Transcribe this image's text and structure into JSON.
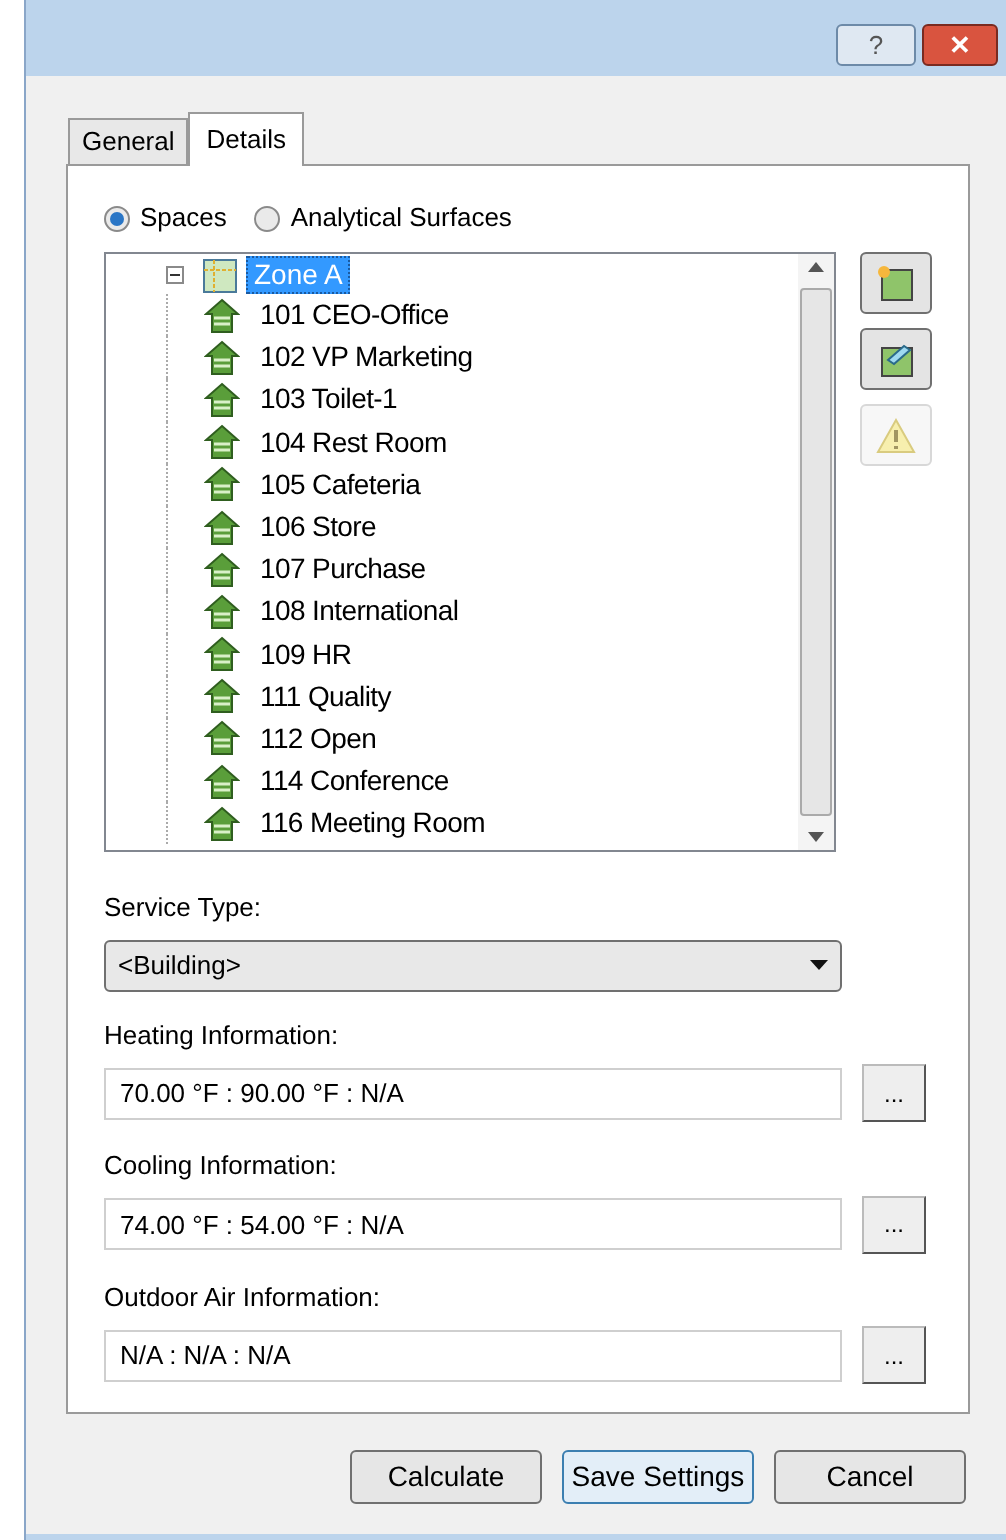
{
  "title_bar": {
    "buttons": [
      {
        "kind": "help",
        "label": "?"
      },
      {
        "kind": "close",
        "label": "✕"
      }
    ]
  },
  "tabs": [
    {
      "label": "General",
      "selected": false
    },
    {
      "label": "Details",
      "selected": true
    }
  ],
  "radios": [
    {
      "label": "Spaces",
      "selected": true
    },
    {
      "label": "Analytical Surfaces",
      "selected": false
    }
  ],
  "tree": {
    "root": {
      "label": "Zone A",
      "expanded": true,
      "selected": true,
      "children": [
        {
          "label": "101 CEO-Office"
        },
        {
          "label": "102 VP Marketing"
        },
        {
          "label": "103 Toilet-1"
        },
        {
          "label": "104 Rest Room"
        },
        {
          "label": "105 Cafeteria"
        },
        {
          "label": "106 Store"
        },
        {
          "label": "107 Purchase"
        },
        {
          "label": "108 International"
        },
        {
          "label": "109 HR"
        },
        {
          "label": "111 Quality"
        },
        {
          "label": "112 Open"
        },
        {
          "label": "114 Conference"
        },
        {
          "label": "116 Meeting Room"
        }
      ]
    }
  },
  "side_buttons": [
    {
      "kind": "space",
      "disabled": false
    },
    {
      "kind": "edit",
      "disabled": false
    },
    {
      "kind": "warning",
      "disabled": true
    }
  ],
  "service_type": {
    "label": "Service Type:",
    "value": "<Building>"
  },
  "fields": [
    {
      "label": "Heating Information:",
      "value": "70.00 °F : 90.00 °F : N/A",
      "button": "..."
    },
    {
      "label": "Cooling Information:",
      "value": "74.00 °F : 54.00 °F : N/A",
      "button": "..."
    },
    {
      "label": "Outdoor Air Information:",
      "value": "N/A : N/A : N/A",
      "button": "..."
    }
  ],
  "buttons": [
    {
      "label": "Calculate",
      "selected": false
    },
    {
      "label": "Save Settings",
      "selected": true
    },
    {
      "label": "Cancel",
      "selected": false
    }
  ]
}
